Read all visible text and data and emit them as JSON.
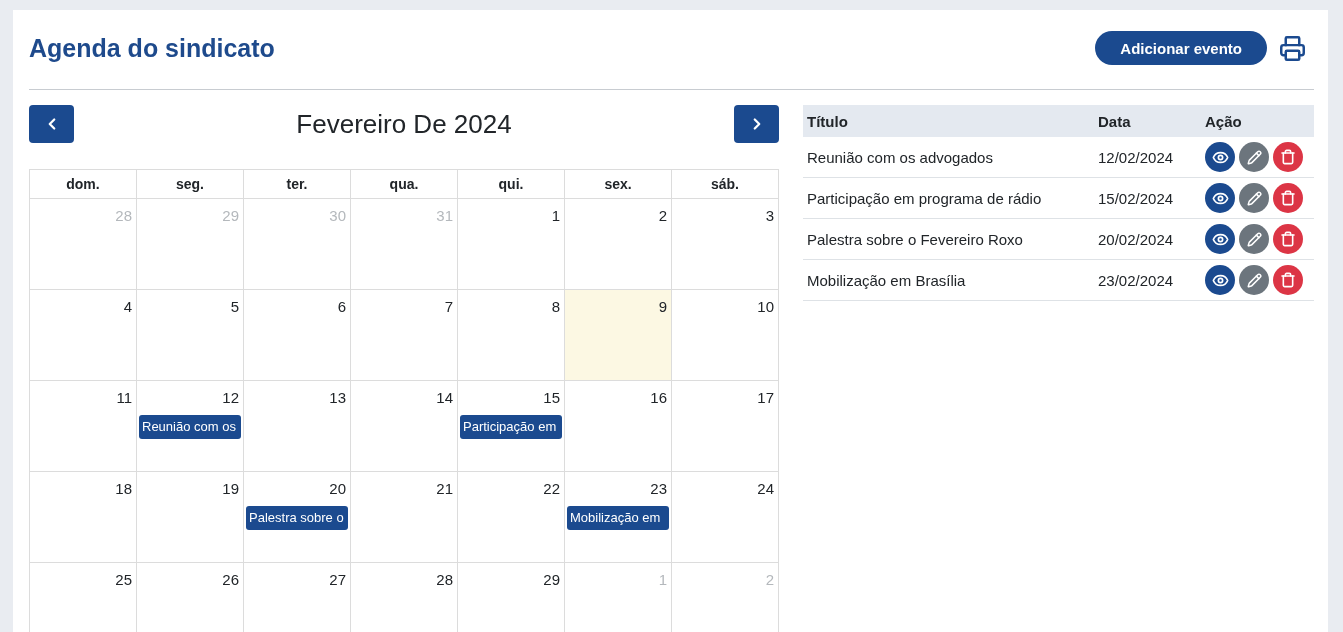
{
  "header": {
    "title": "Agenda do sindicato",
    "add_button": "Adicionar evento"
  },
  "calendar": {
    "title": "Fevereiro De 2024",
    "weekdays": [
      "dom.",
      "seg.",
      "ter.",
      "qua.",
      "qui.",
      "sex.",
      "sáb."
    ],
    "weeks": [
      {
        "days": [
          {
            "day": "28",
            "outside": true,
            "today": false
          },
          {
            "day": "29",
            "outside": true,
            "today": false
          },
          {
            "day": "30",
            "outside": true,
            "today": false
          },
          {
            "day": "31",
            "outside": true,
            "today": false
          },
          {
            "day": "1",
            "outside": false,
            "today": false
          },
          {
            "day": "2",
            "outside": false,
            "today": false
          },
          {
            "day": "3",
            "outside": false,
            "today": false
          }
        ]
      },
      {
        "days": [
          {
            "day": "4",
            "outside": false,
            "today": false
          },
          {
            "day": "5",
            "outside": false,
            "today": false
          },
          {
            "day": "6",
            "outside": false,
            "today": false
          },
          {
            "day": "7",
            "outside": false,
            "today": false
          },
          {
            "day": "8",
            "outside": false,
            "today": false
          },
          {
            "day": "9",
            "outside": false,
            "today": true
          },
          {
            "day": "10",
            "outside": false,
            "today": false
          }
        ]
      },
      {
        "days": [
          {
            "day": "11",
            "outside": false,
            "today": false
          },
          {
            "day": "12",
            "outside": false,
            "today": false,
            "event": "Reunião com os"
          },
          {
            "day": "13",
            "outside": false,
            "today": false
          },
          {
            "day": "14",
            "outside": false,
            "today": false
          },
          {
            "day": "15",
            "outside": false,
            "today": false,
            "event": "Participação em"
          },
          {
            "day": "16",
            "outside": false,
            "today": false
          },
          {
            "day": "17",
            "outside": false,
            "today": false
          }
        ]
      },
      {
        "days": [
          {
            "day": "18",
            "outside": false,
            "today": false
          },
          {
            "day": "19",
            "outside": false,
            "today": false
          },
          {
            "day": "20",
            "outside": false,
            "today": false,
            "event": "Palestra sobre o"
          },
          {
            "day": "21",
            "outside": false,
            "today": false
          },
          {
            "day": "22",
            "outside": false,
            "today": false
          },
          {
            "day": "23",
            "outside": false,
            "today": false,
            "event": "Mobilização em"
          },
          {
            "day": "24",
            "outside": false,
            "today": false
          }
        ]
      },
      {
        "days": [
          {
            "day": "25",
            "outside": false,
            "today": false
          },
          {
            "day": "26",
            "outside": false,
            "today": false
          },
          {
            "day": "27",
            "outside": false,
            "today": false
          },
          {
            "day": "28",
            "outside": false,
            "today": false
          },
          {
            "day": "29",
            "outside": false,
            "today": false
          },
          {
            "day": "1",
            "outside": true,
            "today": false
          },
          {
            "day": "2",
            "outside": true,
            "today": false
          }
        ]
      }
    ]
  },
  "events_table": {
    "columns": [
      "Título",
      "Data",
      "Ação"
    ],
    "rows": [
      {
        "title": "Reunião com os advogados",
        "date": "12/02/2024"
      },
      {
        "title": "Participação em programa de rádio",
        "date": "15/02/2024"
      },
      {
        "title": "Palestra sobre o Fevereiro Roxo",
        "date": "20/02/2024"
      },
      {
        "title": "Mobilização em Brasília",
        "date": "23/02/2024"
      }
    ]
  }
}
